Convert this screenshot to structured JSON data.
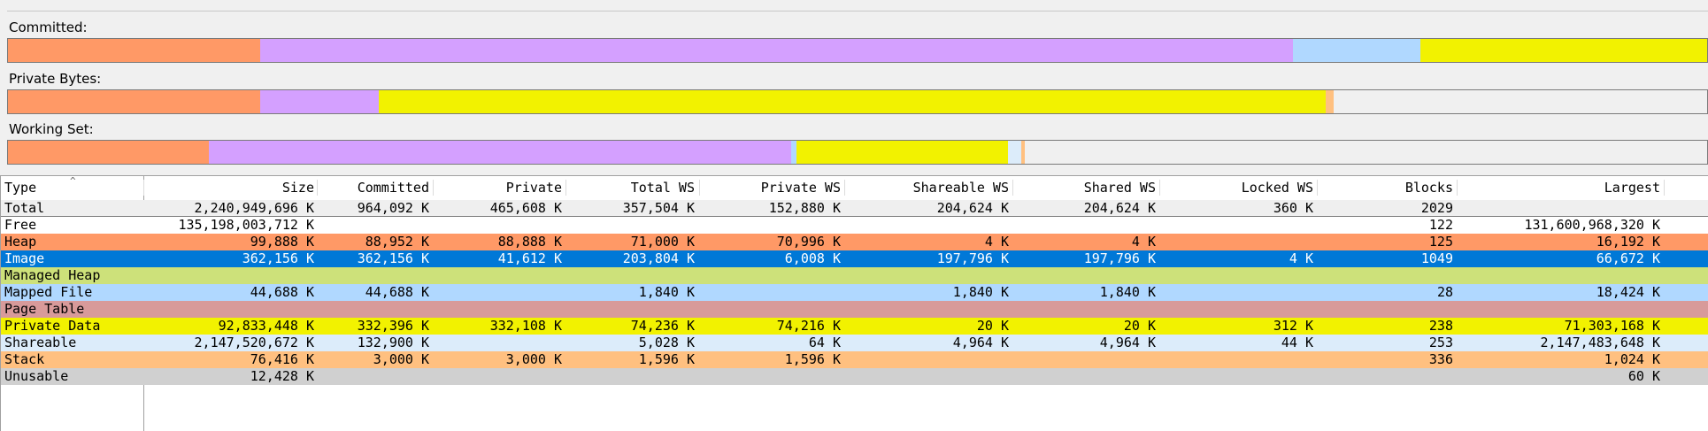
{
  "bars": {
    "committed_label": "Committed:",
    "private_label": "Private Bytes:",
    "working_label": "Working Set:"
  },
  "colors": {
    "heap": "#ff9966",
    "image": "#d4a0ff",
    "mapped_file": "#b0d8ff",
    "private_data": "#f2f200",
    "shareable": "#dcecfa",
    "stack": "#ffc080",
    "image_row_selected": "#0078d7",
    "managed_heap": "#cde17a",
    "page_table": "#d89a9a",
    "unusable": "#d0d0d0",
    "total": "#efefef"
  },
  "table": {
    "columns": [
      "Type",
      "Size",
      "Committed",
      "Private",
      "Total WS",
      "Private WS",
      "Shareable WS",
      "Shared WS",
      "Locked WS",
      "Blocks",
      "Largest"
    ],
    "rows": [
      {
        "type": "Total",
        "size": "2,240,949,696 K",
        "committed": "964,092 K",
        "private": "465,608 K",
        "total_ws": "357,504 K",
        "private_ws": "152,880 K",
        "shareable_ws": "204,624 K",
        "shared_ws": "204,624 K",
        "locked_ws": "360 K",
        "blocks": "2029",
        "largest": ""
      },
      {
        "type": "Free",
        "size": "135,198,003,712 K",
        "committed": "",
        "private": "",
        "total_ws": "",
        "private_ws": "",
        "shareable_ws": "",
        "shared_ws": "",
        "locked_ws": "",
        "blocks": "122",
        "largest": "131,600,968,320 K"
      },
      {
        "type": "Heap",
        "size": "99,888 K",
        "committed": "88,952 K",
        "private": "88,888 K",
        "total_ws": "71,000 K",
        "private_ws": "70,996 K",
        "shareable_ws": "4 K",
        "shared_ws": "4 K",
        "locked_ws": "",
        "blocks": "125",
        "largest": "16,192 K"
      },
      {
        "type": "Image",
        "size": "362,156 K",
        "committed": "362,156 K",
        "private": "41,612 K",
        "total_ws": "203,804 K",
        "private_ws": "6,008 K",
        "shareable_ws": "197,796 K",
        "shared_ws": "197,796 K",
        "locked_ws": "4 K",
        "blocks": "1049",
        "largest": "66,672 K"
      },
      {
        "type": "Managed Heap",
        "size": "",
        "committed": "",
        "private": "",
        "total_ws": "",
        "private_ws": "",
        "shareable_ws": "",
        "shared_ws": "",
        "locked_ws": "",
        "blocks": "",
        "largest": ""
      },
      {
        "type": "Mapped File",
        "size": "44,688 K",
        "committed": "44,688 K",
        "private": "",
        "total_ws": "1,840 K",
        "private_ws": "",
        "shareable_ws": "1,840 K",
        "shared_ws": "1,840 K",
        "locked_ws": "",
        "blocks": "28",
        "largest": "18,424 K"
      },
      {
        "type": "Page Table",
        "size": "",
        "committed": "",
        "private": "",
        "total_ws": "",
        "private_ws": "",
        "shareable_ws": "",
        "shared_ws": "",
        "locked_ws": "",
        "blocks": "",
        "largest": ""
      },
      {
        "type": "Private Data",
        "size": "92,833,448 K",
        "committed": "332,396 K",
        "private": "332,108 K",
        "total_ws": "74,236 K",
        "private_ws": "74,216 K",
        "shareable_ws": "20 K",
        "shared_ws": "20 K",
        "locked_ws": "312 K",
        "blocks": "238",
        "largest": "71,303,168 K"
      },
      {
        "type": "Shareable",
        "size": "2,147,520,672 K",
        "committed": "132,900 K",
        "private": "",
        "total_ws": "5,028 K",
        "private_ws": "64 K",
        "shareable_ws": "4,964 K",
        "shared_ws": "4,964 K",
        "locked_ws": "44 K",
        "blocks": "253",
        "largest": "2,147,483,648 K"
      },
      {
        "type": "Stack",
        "size": "76,416 K",
        "committed": "3,000 K",
        "private": "3,000 K",
        "total_ws": "1,596 K",
        "private_ws": "1,596 K",
        "shareable_ws": "",
        "shared_ws": "",
        "locked_ws": "",
        "blocks": "336",
        "largest": "1,024 K"
      },
      {
        "type": "Unusable",
        "size": "12,428 K",
        "committed": "",
        "private": "",
        "total_ws": "",
        "private_ws": "",
        "shareable_ws": "",
        "shared_ws": "",
        "locked_ws": "",
        "blocks": "",
        "largest": "60 K"
      }
    ]
  }
}
